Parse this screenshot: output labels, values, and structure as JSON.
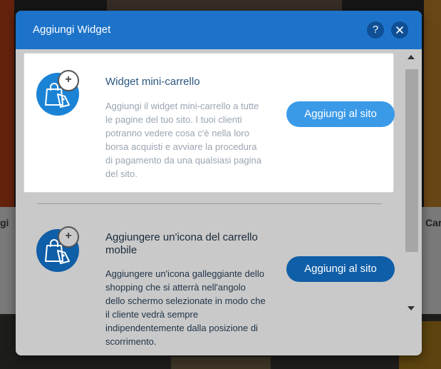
{
  "background": {
    "left_label": "gi",
    "right_label": "Car"
  },
  "dialog": {
    "title": "Aggiungi Widget",
    "help_label": "?",
    "close_label": "✕"
  },
  "widgets": [
    {
      "title": "Widget mini-carrello",
      "description": "Aggiungi il widget mini-carrello a tutte le pagine del tuo sito. I tuoi clienti potranno vedere cosa c'è nella loro borsa acquisti e avviare la procedura di pagamento da una qualsiasi pagina del sito.",
      "button_label": "Aggiungi al sito",
      "badge": "+",
      "icon": "shopping-bag-icon"
    },
    {
      "title": "Aggiungere un'icona del carrello mobile",
      "description": "Aggiungere un'icona galleggiante dello shopping che si atterrà nell'angolo dello schermo selezionate in modo che il cliente vedrà sempre indipendentemente dalla posizione di scorrimento.",
      "button_label": "Aggiungi al sito",
      "badge": "+",
      "icon": "shopping-bag-icon"
    }
  ],
  "colors": {
    "header": "#1d73c9",
    "primary_button": "#3b9ae8",
    "secondary_button": "#0f5ea8"
  }
}
